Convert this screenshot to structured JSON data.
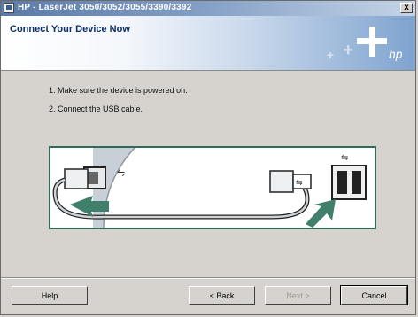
{
  "window": {
    "title": "HP - LaserJet 3050/3052/3055/3390/3392",
    "close_label": "x"
  },
  "header": {
    "title": "Connect Your Device Now",
    "logo_text": "hp"
  },
  "steps": [
    "1. Make sure the device is powered on.",
    "2. Connect the USB cable."
  ],
  "illustration": {
    "usb_symbol": "⇋"
  },
  "buttons": {
    "help": "Help",
    "back": "< Back",
    "next": "Next >",
    "cancel": "Cancel"
  },
  "colors": {
    "title_bar": "#5a7aa8",
    "header_title": "#0d2f6a",
    "illustration_border": "#2f6b56",
    "arrow": "#3f7f6c",
    "dialog_bg": "#d6d3ce"
  }
}
